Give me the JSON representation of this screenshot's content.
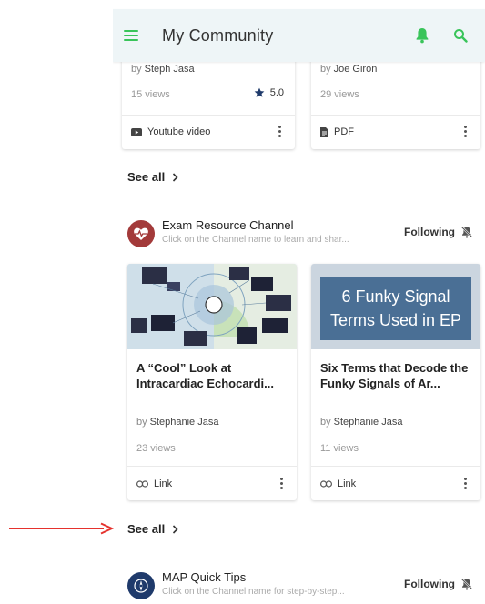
{
  "header": {
    "title": "My Community",
    "menu_icon": "menu-icon",
    "bell_icon": "bell-icon",
    "search_icon": "search-icon",
    "accent": "#39c45a"
  },
  "top_cards": [
    {
      "by": "by",
      "author": "Steph Jasa",
      "views": "15 views",
      "rating": "5.0",
      "type": "Youtube video",
      "type_icon": "youtube-icon"
    },
    {
      "by": "by",
      "author": "Joe Giron",
      "views": "29 views",
      "type": "PDF",
      "type_icon": "pdf-icon"
    }
  ],
  "see_all_1": "See all",
  "channel_1": {
    "name": "Exam Resource Channel",
    "description": "Click on the Channel name to learn and shar...",
    "follow": "Following",
    "avatar_color": "#a33a3a"
  },
  "channel_1_cards": [
    {
      "title": "A “Cool” Look at Intracardiac Echocardi...",
      "by": "by",
      "author": "Stephanie Jasa",
      "views": "23 views",
      "type": "Link",
      "type_icon": "link-icon"
    },
    {
      "thumb_text": "6 Funky Signal Terms Used in EP",
      "title": "Six Terms that Decode the Funky Signals of Ar...",
      "by": "by",
      "author": "Stephanie Jasa",
      "views": "11 views",
      "type": "Link",
      "type_icon": "link-icon"
    }
  ],
  "see_all_2": "See all",
  "channel_2": {
    "name": "MAP Quick Tips",
    "description": "Click on the Channel name for step-by-step...",
    "follow": "Following",
    "avatar_color": "#1f3a6b"
  },
  "annotation": {
    "arrow_color": "#e5322d"
  }
}
